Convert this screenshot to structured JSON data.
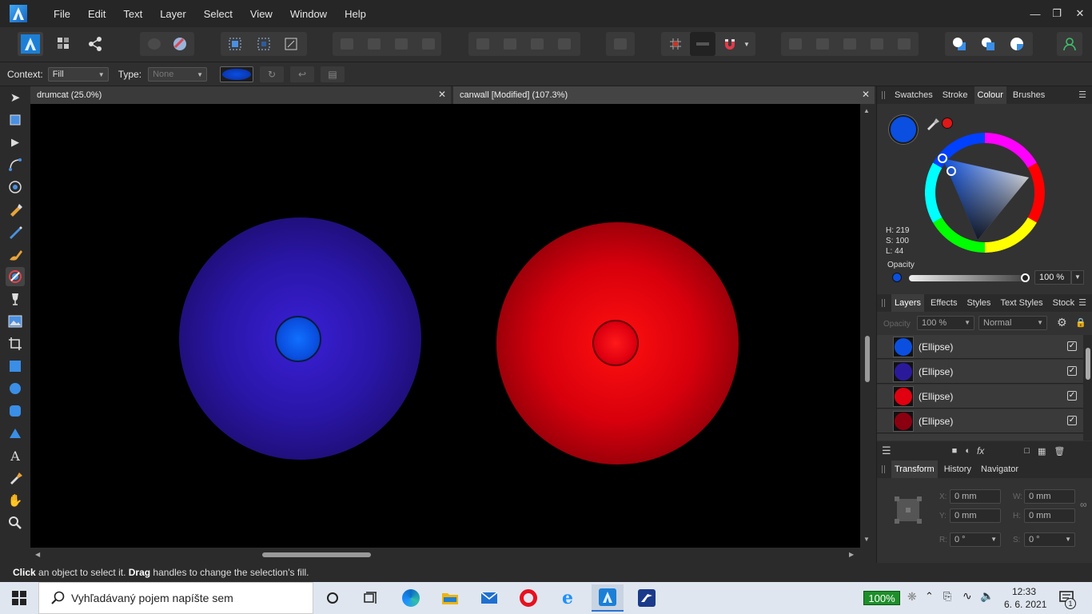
{
  "menubar": {
    "items": [
      "File",
      "Edit",
      "Text",
      "Layer",
      "Select",
      "View",
      "Window",
      "Help"
    ]
  },
  "context_bar": {
    "context_label": "Context:",
    "context_value": "Fill",
    "type_label": "Type:",
    "type_value": "None"
  },
  "tabs": [
    {
      "label": "drumcat (25.0%)"
    },
    {
      "label": "canwall [Modified] (107.3%)"
    }
  ],
  "status": {
    "click": "Click",
    "click_rest": " an object to select it. ",
    "drag": "Drag",
    "drag_rest": " handles to change the selection's fill."
  },
  "colour_panel": {
    "tabs": [
      "Swatches",
      "Stroke",
      "Colour",
      "Brushes"
    ],
    "active_tab": "Colour",
    "h": "H: 219",
    "s": "S: 100",
    "l": "L: 44",
    "opacity_label": "Opacity",
    "opacity_value": "100 %",
    "current_color": "#0a4fe0"
  },
  "layers_panel": {
    "tabs": [
      "Layers",
      "Effects",
      "Styles",
      "Text Styles",
      "Stock"
    ],
    "opacity_label": "Opacity",
    "opacity_value": "100 %",
    "blend_mode": "Normal",
    "layers": [
      {
        "name": "(Ellipse)",
        "color": "#0a4fe0"
      },
      {
        "name": "(Ellipse)",
        "color": "#2a1a9a"
      },
      {
        "name": "(Ellipse)",
        "color": "#e00010"
      },
      {
        "name": "(Ellipse)",
        "color": "#8a0010"
      }
    ]
  },
  "transform_panel": {
    "tabs": [
      "Transform",
      "History",
      "Navigator"
    ],
    "x_label": "X:",
    "x": "0 mm",
    "y_label": "Y:",
    "y": "0 mm",
    "w_label": "W:",
    "w": "0 mm",
    "h_label": "H:",
    "h": "0 mm",
    "r_label": "R:",
    "r": "0 °",
    "s_label": "S:",
    "s": "0 °"
  },
  "taskbar": {
    "search_placeholder": "Vyhľadávaný pojem napíšte sem",
    "battery": "100%",
    "time": "12:33",
    "date": "6. 6. 2021",
    "notification_count": "1"
  }
}
